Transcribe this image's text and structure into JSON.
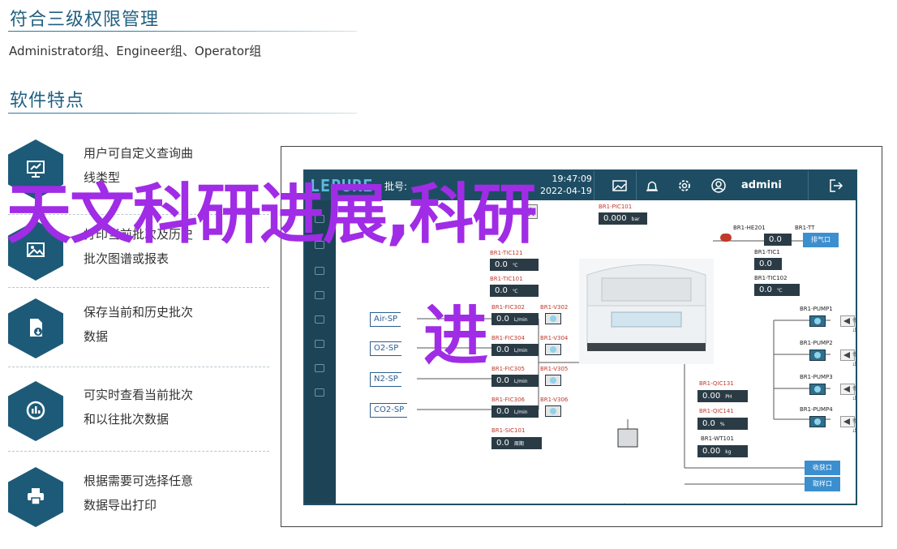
{
  "page": {
    "heading1": "符合三级权限管理",
    "roles_line": "Administrator组、Engineer组、Operator组",
    "heading2": "软件特点"
  },
  "features": [
    {
      "icon": "chart-presentation-icon",
      "line1": "用户可自定义查询曲",
      "line2": "线类型"
    },
    {
      "icon": "image-gallery-icon",
      "line1": "打印当前批次及历史",
      "line2": "批次图谱或报表"
    },
    {
      "icon": "file-download-icon",
      "line1": "保存当前和历史批次",
      "line2": "数据"
    },
    {
      "icon": "gauge-chart-icon",
      "line1": "可实时查看当前批次",
      "line2": "和以往批次数据"
    },
    {
      "icon": "printer-icon",
      "line1": "根据需要可选择任意",
      "line2": "数据导出打印"
    }
  ],
  "hmi": {
    "logo": "LEPURE",
    "batch_label": "批号:",
    "time": "19:47:09",
    "date": "2022-04-19",
    "user": "admini",
    "switch_label": "换",
    "icons": [
      "image-icon",
      "alarm-bell-icon",
      "settings-gear-icon",
      "user-account-icon",
      "logout-icon"
    ],
    "sp_inputs": [
      "Air-SP",
      "O2-SP",
      "N2-SP",
      "CO2-SP"
    ],
    "instruments": {
      "pic101": {
        "tag": "BR1-PIC101",
        "value": "0.000",
        "unit": "bar"
      },
      "tic121": {
        "tag": "BR1-TIC121",
        "value": "0.0",
        "unit": "℃"
      },
      "tic101": {
        "tag": "BR1-TIC101",
        "value": "0.0",
        "unit": "℃"
      },
      "fic302": {
        "tag": "BR1-FIC302",
        "value": "0.0",
        "unit": "L/min"
      },
      "fic304": {
        "tag": "BR1-FIC304",
        "value": "0.0",
        "unit": "L/min"
      },
      "fic305": {
        "tag": "BR1-FIC305",
        "value": "0.0",
        "unit": "L/min"
      },
      "fic306": {
        "tag": "BR1-FIC306",
        "value": "0.0",
        "unit": "L/min"
      },
      "sic101": {
        "tag": "BR1-SIC101",
        "value": "0.0",
        "unit": "周期"
      },
      "he201": {
        "tag": "BR1-HE201"
      },
      "tt": {
        "tag": "BR1-TT",
        "value": "0.0"
      },
      "tic1": {
        "tag": "BR1-TIC1",
        "value": "0.0"
      },
      "tic102": {
        "tag": "BR1-TIC102",
        "value": "0.0",
        "unit": "℃"
      },
      "qic131": {
        "tag": "BR1-QIC131",
        "value": "0.00",
        "unit": "PH"
      },
      "qic141": {
        "tag": "BR1-QIC141",
        "value": "0.0",
        "unit": "%"
      },
      "wt101": {
        "tag": "BR1-WT101",
        "value": "0.00",
        "unit": "kg"
      }
    },
    "valves": [
      "BR1-V302",
      "BR1-V304",
      "BR1-V305",
      "BR1-V306"
    ],
    "pumps": [
      "BR1-PUMP1",
      "BR1-PUMP2",
      "BR1-PUMP3",
      "BR1-PUMP4"
    ],
    "pump_states": [
      "停止",
      "停止",
      "停止",
      "停止"
    ],
    "buttons": {
      "exhaust": "排气口",
      "harvest": "收获口",
      "sample": "取样口"
    }
  },
  "overlay": {
    "line1": "天文科研进展,科研",
    "line2": "进"
  },
  "colors": {
    "accent": "#1d5a78",
    "overlay": "#a02ce6",
    "hmi_bar": "#1e4d63"
  }
}
